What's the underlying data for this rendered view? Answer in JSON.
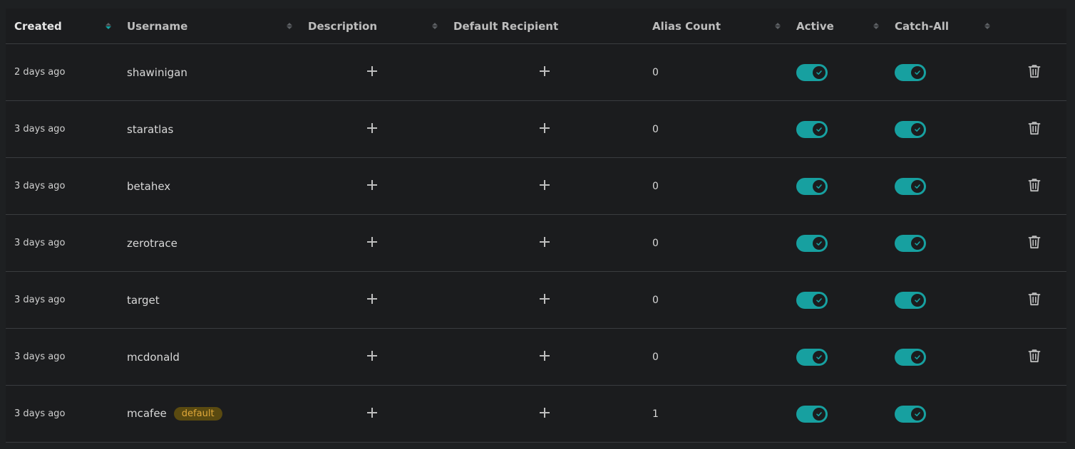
{
  "columns": {
    "created": "Created",
    "username": "Username",
    "description": "Description",
    "default_recipient": "Default Recipient",
    "alias_count": "Alias Count",
    "active": "Active",
    "catch_all": "Catch-All"
  },
  "colors": {
    "accent": "#17a0a0",
    "badge_bg": "#5a4a10",
    "badge_text": "#e0a83a"
  },
  "rows": [
    {
      "created": "2 days ago",
      "username": "shawinigan",
      "alias_count": "0",
      "active": true,
      "catch_all": true,
      "badge": "",
      "deletable": true
    },
    {
      "created": "3 days ago",
      "username": "staratlas",
      "alias_count": "0",
      "active": true,
      "catch_all": true,
      "badge": "",
      "deletable": true
    },
    {
      "created": "3 days ago",
      "username": "betahex",
      "alias_count": "0",
      "active": true,
      "catch_all": true,
      "badge": "",
      "deletable": true
    },
    {
      "created": "3 days ago",
      "username": "zerotrace",
      "alias_count": "0",
      "active": true,
      "catch_all": true,
      "badge": "",
      "deletable": true
    },
    {
      "created": "3 days ago",
      "username": "target",
      "alias_count": "0",
      "active": true,
      "catch_all": true,
      "badge": "",
      "deletable": true
    },
    {
      "created": "3 days ago",
      "username": "mcdonald",
      "alias_count": "0",
      "active": true,
      "catch_all": true,
      "badge": "",
      "deletable": true
    },
    {
      "created": "3 days ago",
      "username": "mcafee",
      "alias_count": "1",
      "active": true,
      "catch_all": true,
      "badge": "default",
      "deletable": false
    }
  ]
}
